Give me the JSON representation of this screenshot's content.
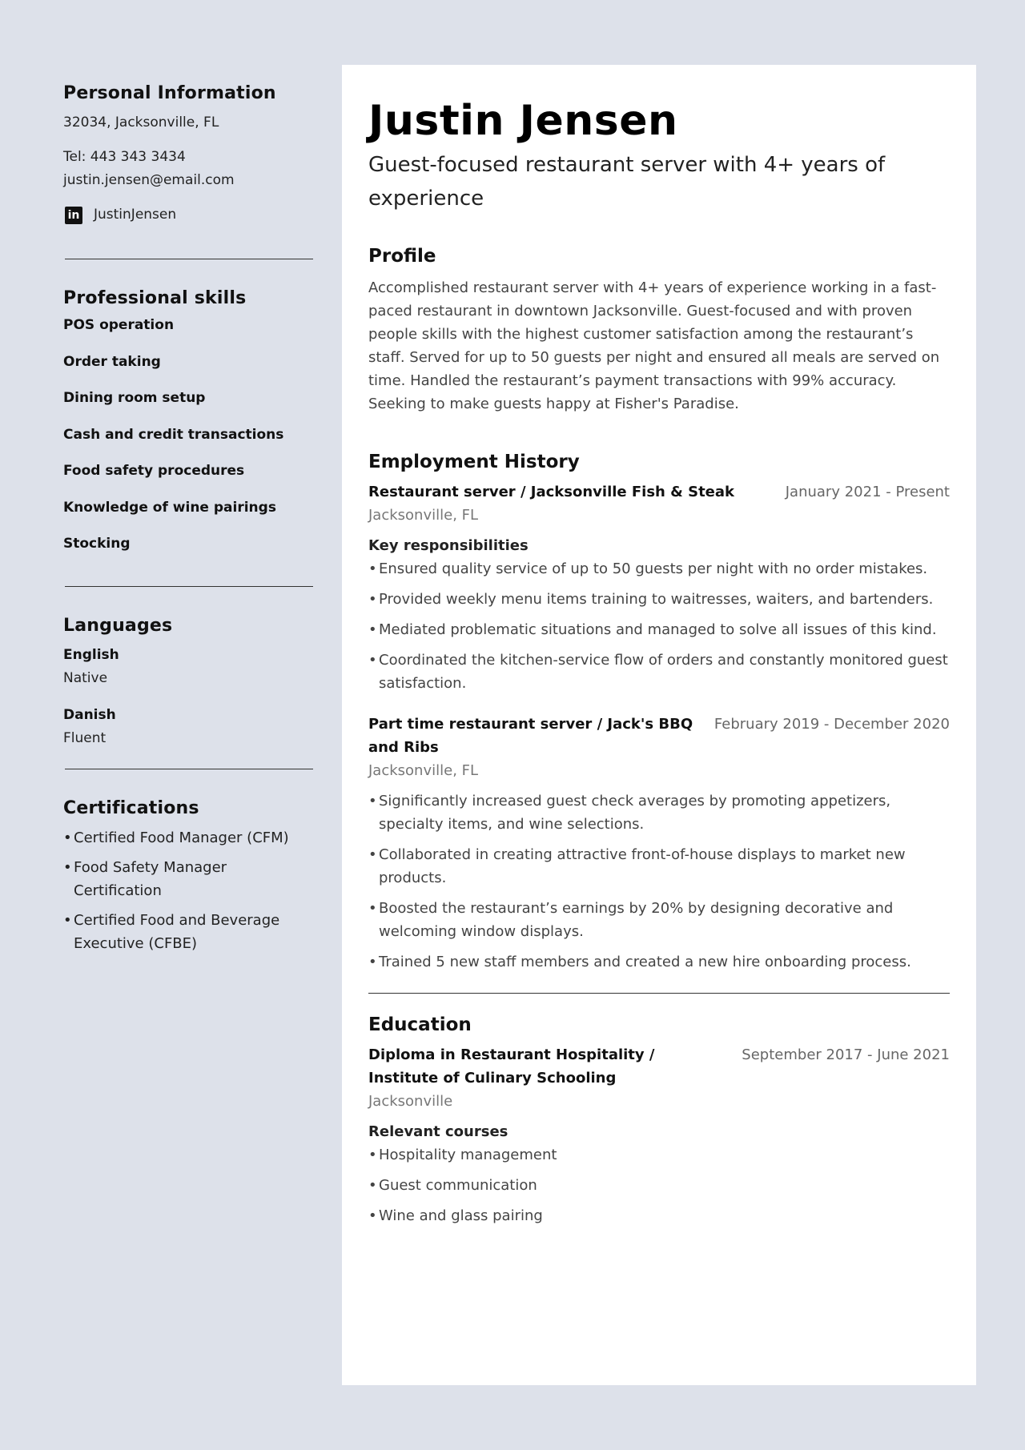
{
  "sidebar": {
    "personal": {
      "title": "Personal Information",
      "address": "32034, Jacksonville, FL",
      "phone": "Tel: 443 343 3434",
      "email": "justin.jensen@email.com",
      "linkedin_icon": "linkedin-icon",
      "linkedin_glyph": "in",
      "linkedin": "JustinJensen"
    },
    "skills": {
      "title": "Professional skills",
      "items": [
        "POS operation",
        "Order taking",
        "Dining room setup",
        "Cash and credit transactions",
        "Food safety procedures",
        "Knowledge of wine pairings",
        "Stocking"
      ]
    },
    "languages": {
      "title": "Languages",
      "items": [
        {
          "name": "English",
          "level": "Native"
        },
        {
          "name": "Danish",
          "level": "Fluent"
        }
      ]
    },
    "certifications": {
      "title": "Certifications",
      "bullet": "•",
      "items": [
        "Certified Food Manager (CFM)",
        "Food Safety Manager Certification",
        "Certified Food and Beverage Executive (CFBE)"
      ]
    }
  },
  "main": {
    "name": "Justin Jensen",
    "headline": "Guest-focused restaurant server with 4+ years of experience",
    "profile": {
      "title": "Profile",
      "text": "Accomplished restaurant server with 4+ years of experience working in a fast-paced restaurant in downtown Jacksonville. Guest-focused and with proven people skills with the highest customer satisfaction among the restaurant’s staff. Served for up to 50 guests per night and ensured all meals are served on time. Handled the restaurant’s payment transactions with 99% accuracy. Seeking to make guests happy at Fisher's Paradise."
    },
    "employment": {
      "title": "Employment History",
      "jobs": [
        {
          "title": "Restaurant server  /  Jacksonville Fish & Steak",
          "date": "January 2021 - Present",
          "location": "Jacksonville, FL",
          "subtitle": "Key responsibilities",
          "bullets": [
            "Ensured quality service of up to 50 guests per night with no order mistakes.",
            "Provided weekly menu items training to waitresses, waiters, and bartenders.",
            "Mediated problematic situations and managed to solve all issues of this kind.",
            "Coordinated the kitchen-service flow of orders and constantly monitored guest satisfaction."
          ]
        },
        {
          "title": "Part time restaurant server  /  Jack's BBQ and Ribs",
          "date": "February 2019 - December 2020",
          "location": "Jacksonville, FL",
          "bullets": [
            "Significantly increased guest check averages by promoting appetizers, specialty items, and wine selections.",
            "Collaborated in creating attractive front-of-house displays to market new products.",
            "Boosted the restaurant’s earnings by 20% by designing decorative and welcoming window displays.",
            "Trained 5 new staff members and created a new hire onboarding process."
          ]
        }
      ]
    },
    "education": {
      "title": "Education",
      "degree": "Diploma in Restaurant Hospitality  /  Institute of Culinary Schooling",
      "date": "September 2017 - June 2021",
      "location": "Jacksonville",
      "subtitle": "Relevant courses",
      "courses": [
        "Hospitality management",
        "Guest communication",
        "Wine and glass pairing"
      ]
    },
    "bullet": "•"
  }
}
